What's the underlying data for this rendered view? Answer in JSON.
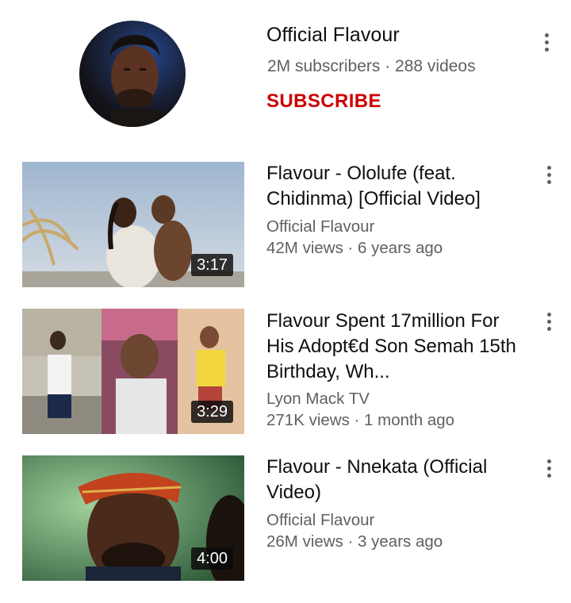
{
  "channel": {
    "name": "Official Flavour",
    "meta": "2M subscribers · 288 videos",
    "subscribe_label": "SUBSCRIBE",
    "accent": "#cc0000"
  },
  "videos": [
    {
      "title": "Flavour - Ololufe (feat. Chidinma) [Official Video]",
      "channel": "Official Flavour",
      "meta": "42M views · 6 years ago",
      "duration": "3:17"
    },
    {
      "title": "Flavour Spent 17million For His Adopt€d Son Semah 15th Birthday, Wh...",
      "channel": "Lyon Mack TV",
      "meta": "271K views · 1 month ago",
      "duration": "3:29"
    },
    {
      "title": "Flavour - Nnekata (Official Video)",
      "channel": "Official Flavour",
      "meta": "26M views · 3 years ago",
      "duration": "4:00"
    }
  ],
  "icons": {
    "menu": "more-vert-icon"
  }
}
